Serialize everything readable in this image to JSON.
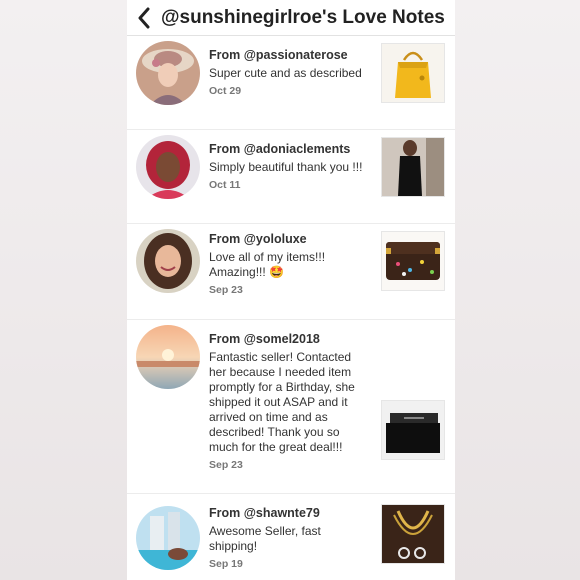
{
  "header": {
    "title": "@sunshinegirlroe's Love Notes",
    "back_icon": "chevron-left-icon"
  },
  "notes": [
    {
      "from": "From @passionaterose",
      "message": "Super cute and as described",
      "date": "Oct 29",
      "avatar": "avatar-vintage-woman",
      "item": "yellow-handbag"
    },
    {
      "from": "From @adoniaclements",
      "message": "Simply beautiful thank you !!!",
      "date": "Oct 11",
      "avatar": "avatar-red-hair-woman",
      "item": "black-dress"
    },
    {
      "from": "From @yololuxe",
      "message": "Love all of my items!!! Amazing!!! 🤩",
      "date": "Sep 23",
      "avatar": "avatar-smiling-woman",
      "item": "monogram-wallet"
    },
    {
      "from": "From @somel2018",
      "message": "Fantastic seller! Contacted her because I needed item promptly for a Birthday, she shipped it out ASAP and it arrived on time and as described! Thank you so much for the great deal!!!",
      "date": "Sep 23",
      "avatar": "avatar-sunset-beach",
      "item": "black-wallet"
    },
    {
      "from": "From @shawnte79",
      "message": "Awesome Seller, fast shipping!",
      "date": "Sep 19",
      "avatar": "avatar-pool-resort",
      "item": "gold-jewelry"
    }
  ]
}
